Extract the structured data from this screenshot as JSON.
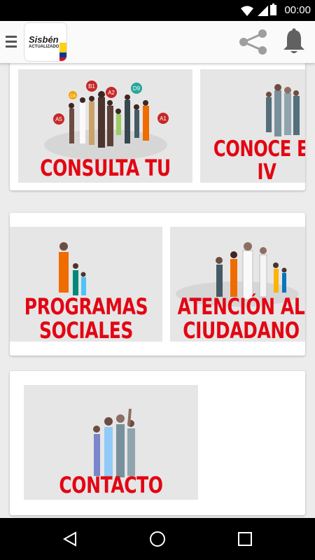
{
  "status_bar": {
    "time": "00:00"
  },
  "app_bar": {
    "logo_text": "Sisbén",
    "logo_subtext": "ACTUALIZADO",
    "flag_colors": [
      "#fcd116",
      "#003893",
      "#ce1126"
    ]
  },
  "tiles": {
    "consulta": {
      "line1": "CONSULTA TU GRUPO"
    },
    "conoce": {
      "line1": "CONOCE ES",
      "line2": "IV"
    },
    "programas": {
      "line1": "PROGRAMAS",
      "line2": "SOCIALES"
    },
    "atencion": {
      "line1": "ATENCIÓN AL",
      "line2": "CIUDADANO"
    },
    "contacto": {
      "line1": "CONTACTO"
    }
  },
  "group_badges": [
    "A5",
    "C6",
    "B1",
    "A2",
    "D9",
    "A1"
  ],
  "colors": {
    "accent": "#e30613",
    "tile_bg": "#e6e6e6"
  }
}
